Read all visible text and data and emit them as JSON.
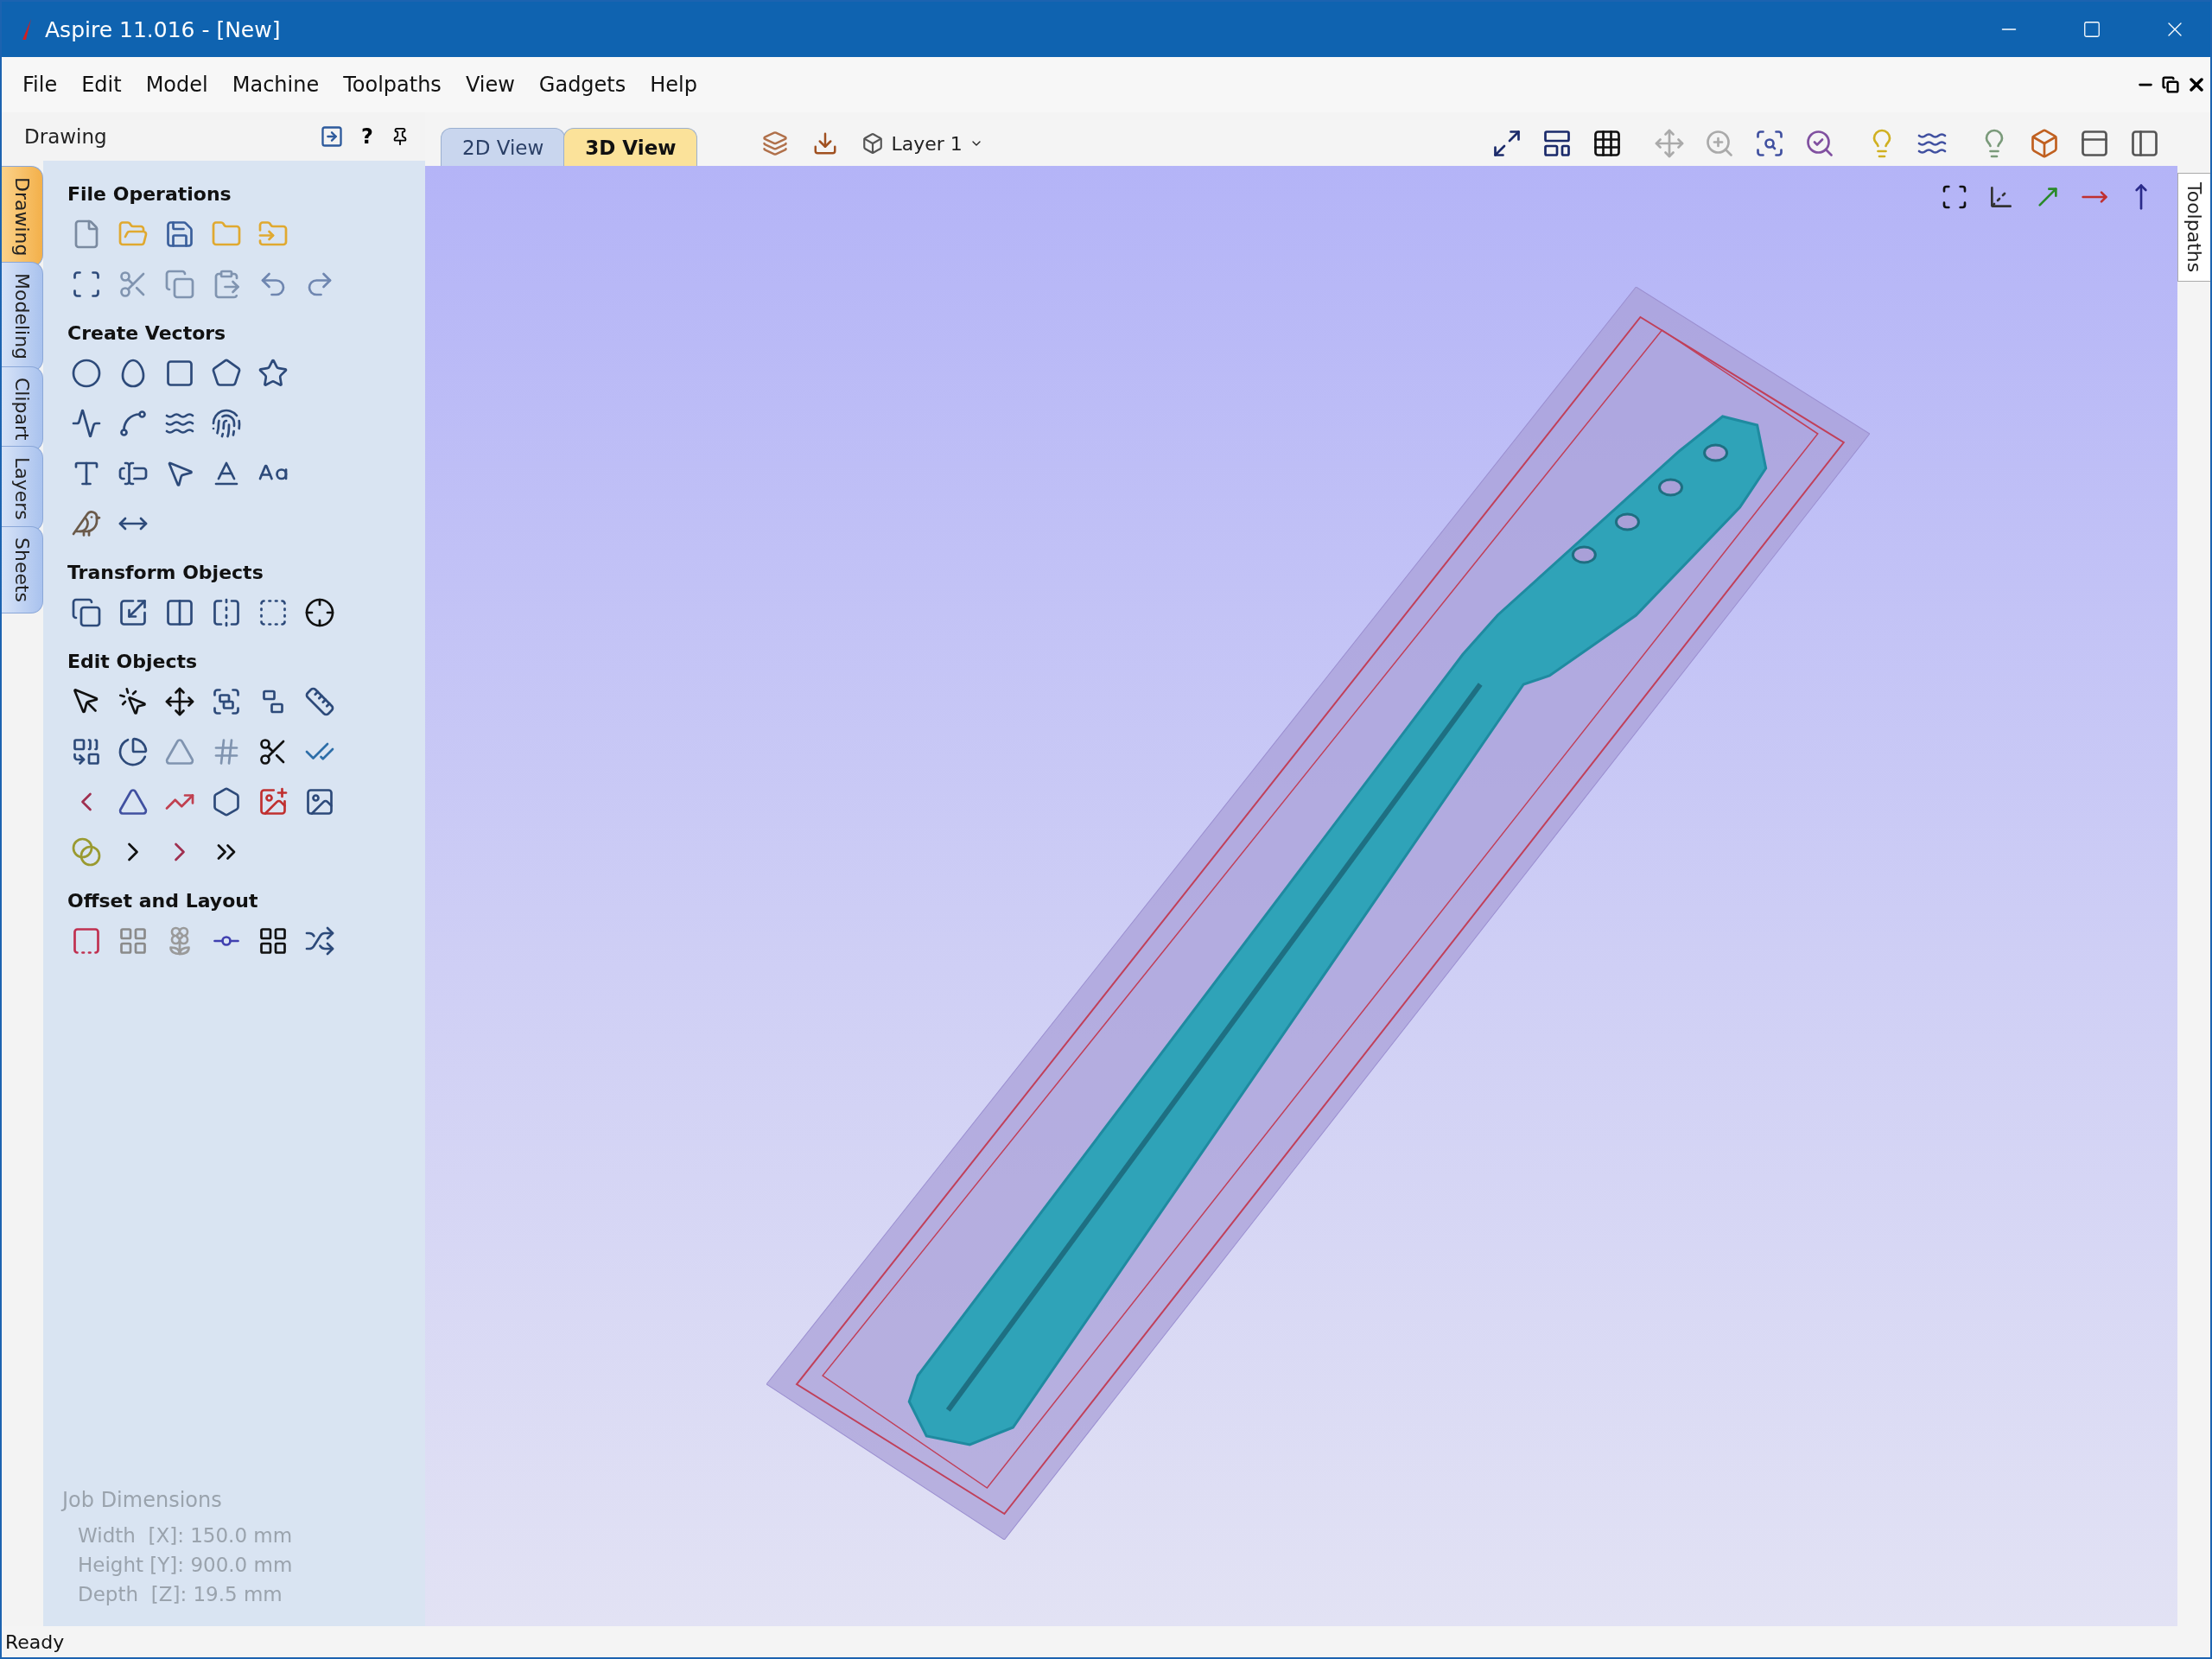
{
  "window": {
    "title": "Aspire 11.016 - [New]"
  },
  "menu": [
    "File",
    "Edit",
    "Model",
    "Machine",
    "Toolpaths",
    "View",
    "Gadgets",
    "Help"
  ],
  "panel": {
    "title": "Drawing",
    "help": "?",
    "side_tabs": [
      {
        "label": "Drawing",
        "selected": true
      },
      {
        "label": "Modeling",
        "selected": false
      },
      {
        "label": "Clipart",
        "selected": false
      },
      {
        "label": "Layers",
        "selected": false
      },
      {
        "label": "Sheets",
        "selected": false
      }
    ],
    "sections": [
      {
        "heading": "File Operations"
      },
      {
        "heading": "Create Vectors"
      },
      {
        "heading": "Transform Objects"
      },
      {
        "heading": "Edit Objects"
      },
      {
        "heading": "Offset and Layout"
      }
    ],
    "job_dimensions": {
      "heading": "Job Dimensions",
      "lines": [
        "Width  [X]: 150.0 mm",
        "Height [Y]: 900.0 mm",
        "Depth  [Z]: 19.5 mm"
      ]
    }
  },
  "view_tabs": [
    {
      "label": "2D View",
      "selected": false
    },
    {
      "label": "3D View",
      "selected": true
    }
  ],
  "layer": "Layer 1",
  "right_tab": {
    "label": "Toolpaths"
  },
  "status_bar": "Ready"
}
